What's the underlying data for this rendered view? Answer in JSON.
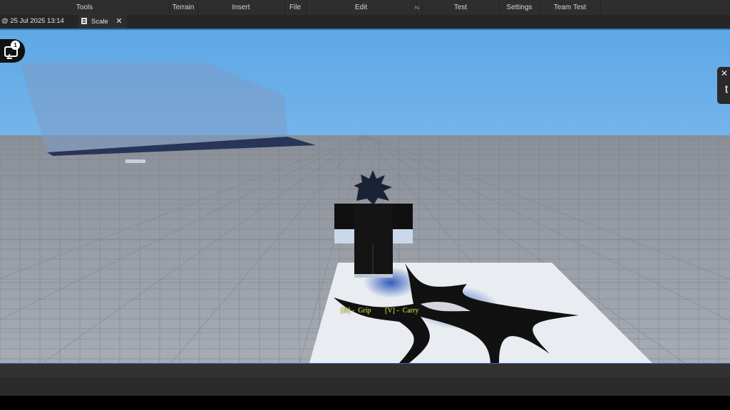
{
  "menu": {
    "items": [
      "Tools",
      "Terrain",
      "Insert",
      "File",
      "Edit",
      "⇆",
      "Test",
      "Settings",
      "Team Test"
    ]
  },
  "tabs": [
    {
      "label": "@ 25 Jul 2025 13:14",
      "close": "✕"
    },
    {
      "label": "Scale",
      "close": "✕"
    }
  ],
  "viewport": {
    "chat_badge": "1",
    "side_panel_close": "✕",
    "side_panel_glyph": "ʈ",
    "hints": [
      {
        "key": "[B]",
        "sep": "-",
        "action": "Grip"
      },
      {
        "key": "[V]",
        "sep": "-",
        "action": "Carry"
      }
    ]
  },
  "colors": {
    "accent": "#2f6fb0",
    "menubar": "#2e2e2e",
    "hint_text": "#d9d936"
  }
}
